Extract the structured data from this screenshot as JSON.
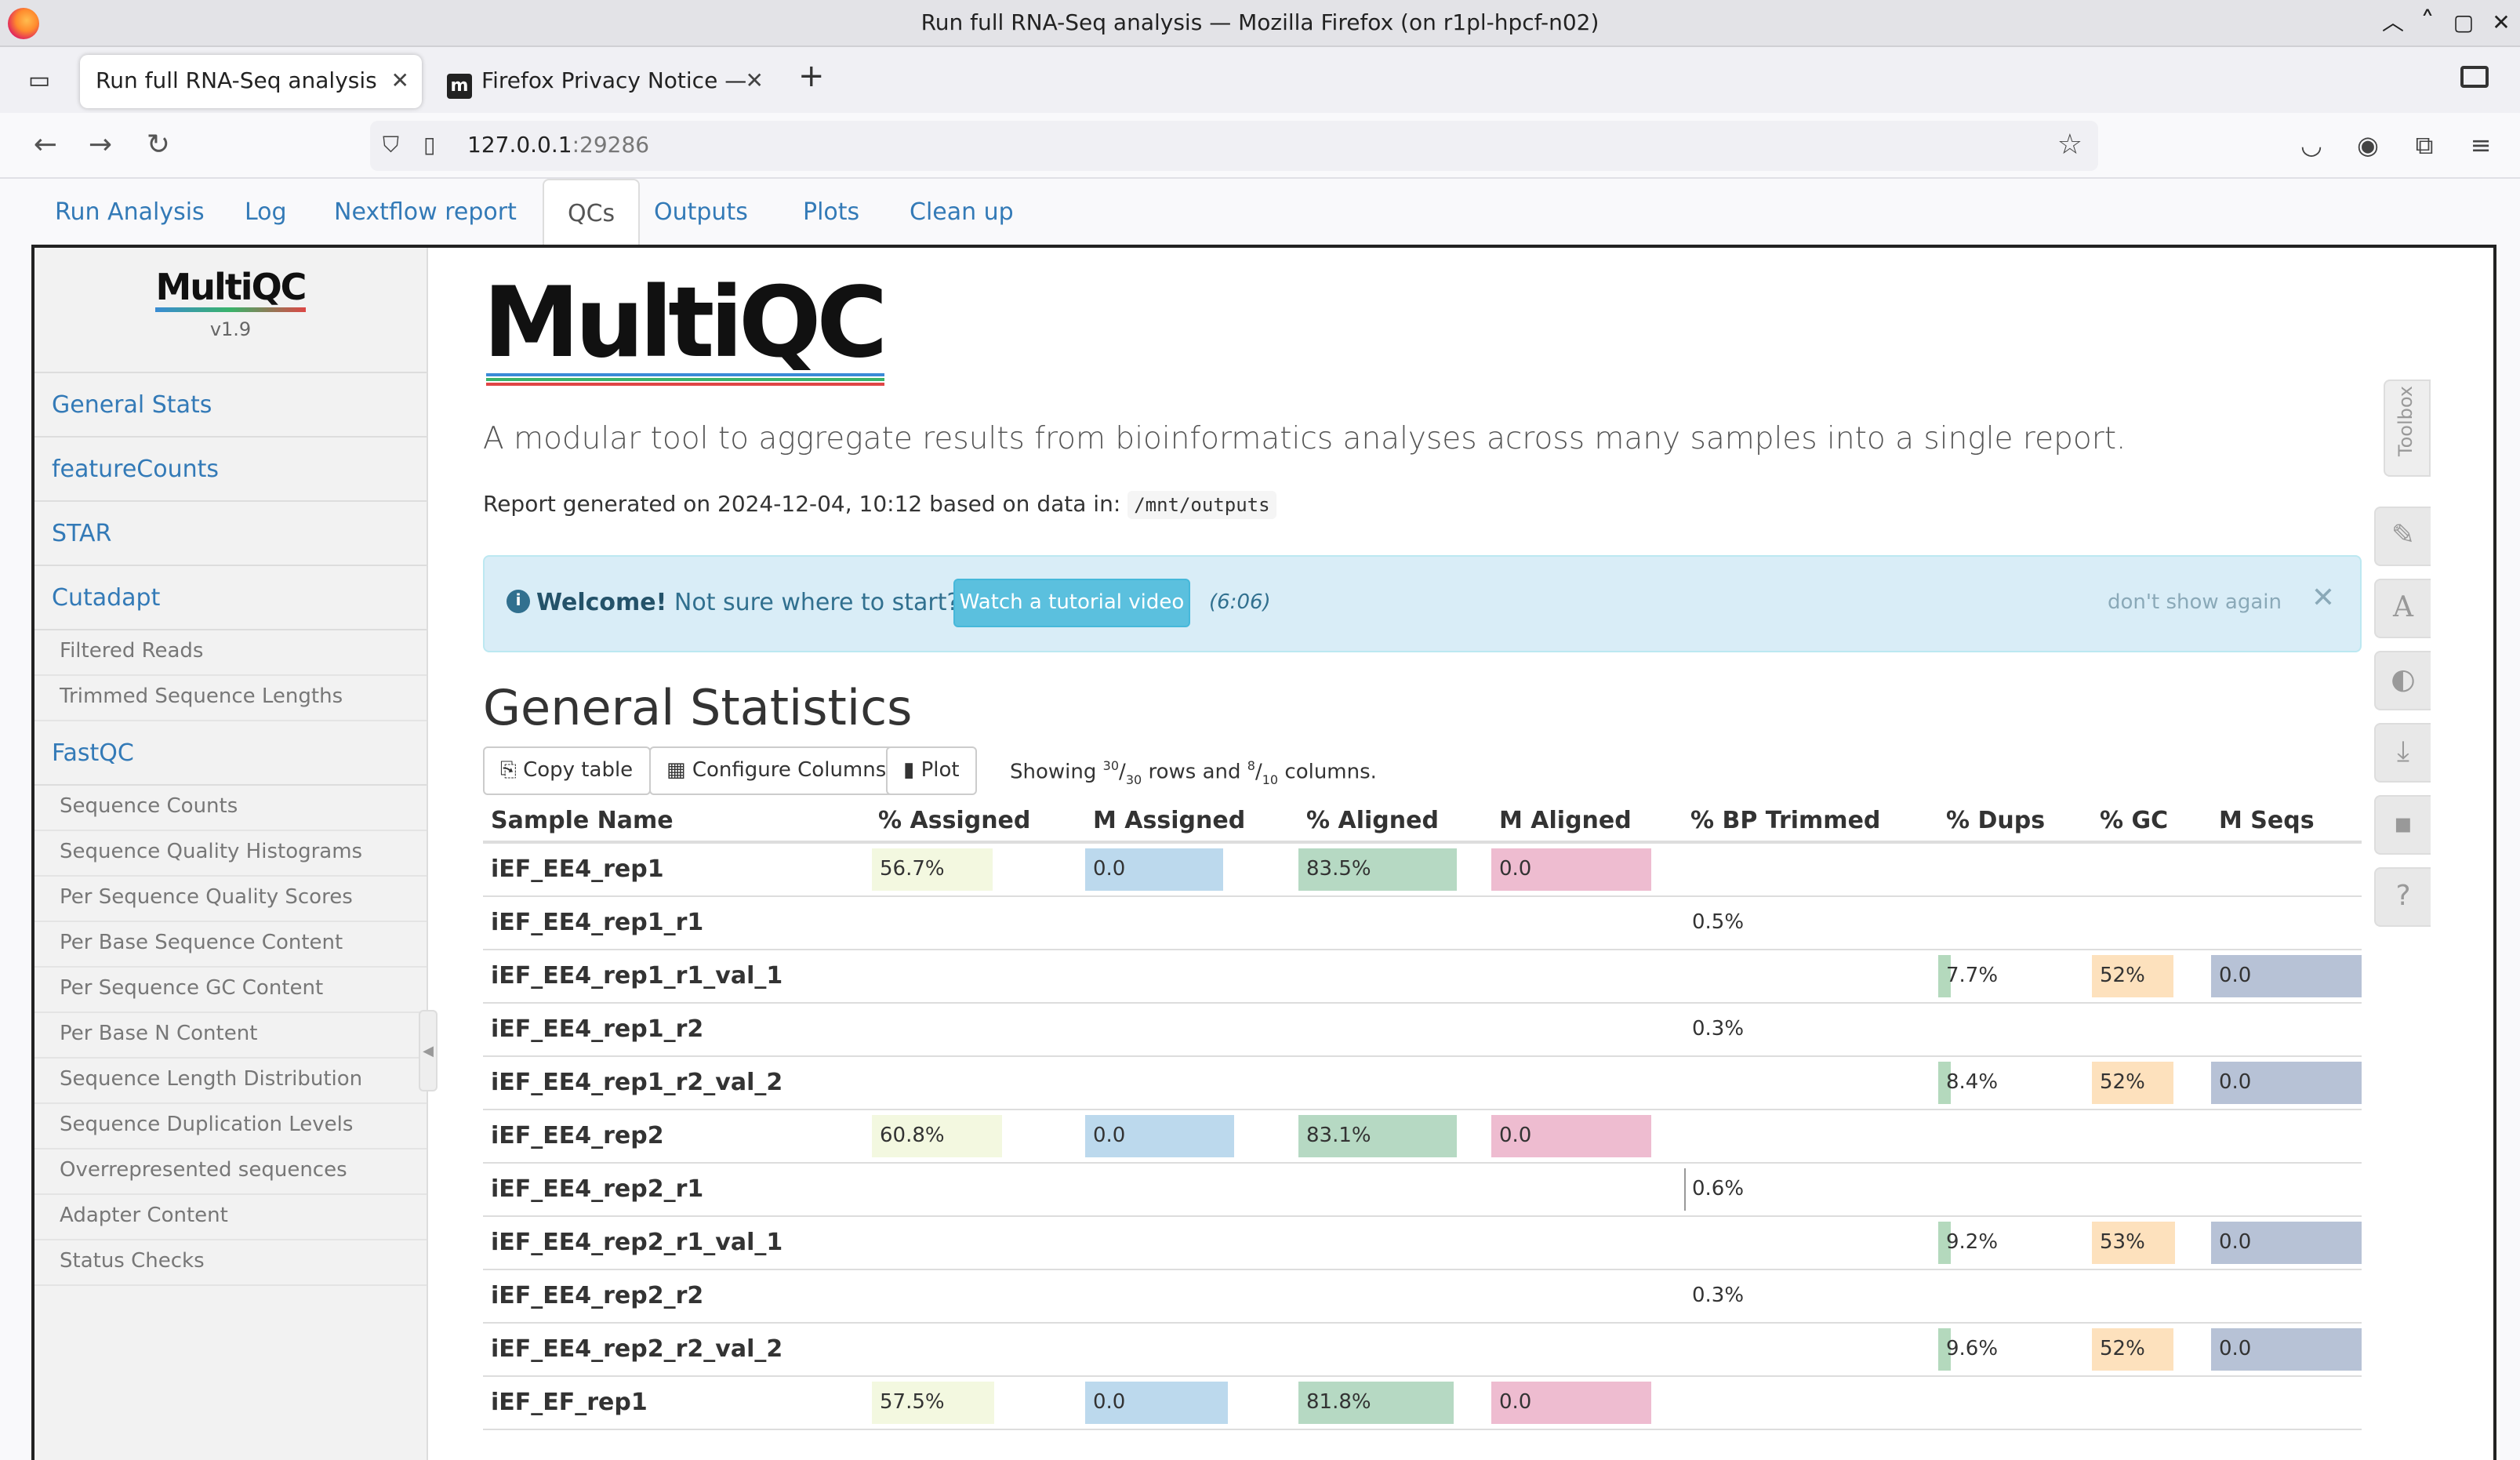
{
  "window": {
    "title": "Run full RNA-Seq analysis — Mozilla Firefox (on r1pl-hpcf-n02)"
  },
  "browser": {
    "tabs": [
      {
        "label": "Run full RNA-Seq analysis",
        "active": true
      },
      {
        "label": "Firefox Privacy Notice — ",
        "favicon": "m",
        "active": false
      }
    ],
    "url_host": "127.0.0.1",
    "url_port": ":29286"
  },
  "app_tabs": [
    "Run Analysis",
    "Log",
    "Nextflow report",
    "QCs",
    "Outputs",
    "Plots",
    "Clean up"
  ],
  "sidebar": {
    "logo": "MultiQC",
    "version": "v1.9",
    "sections": [
      {
        "label": "General Stats"
      },
      {
        "label": "featureCounts"
      },
      {
        "label": "STAR"
      },
      {
        "label": "Cutadapt",
        "subs": [
          "Filtered Reads",
          "Trimmed Sequence Lengths"
        ]
      },
      {
        "label": "FastQC",
        "subs": [
          "Sequence Counts",
          "Sequence Quality Histograms",
          "Per Sequence Quality Scores",
          "Per Base Sequence Content",
          "Per Sequence GC Content",
          "Per Base N Content",
          "Sequence Length Distribution",
          "Sequence Duplication Levels",
          "Overrepresented sequences",
          "Adapter Content",
          "Status Checks"
        ]
      }
    ]
  },
  "main": {
    "logo": "MultiQC",
    "lead": "A modular tool to aggregate results from bioinformatics analyses across many samples into a single report.",
    "generated_prefix": "Report generated on 2024-12-04, 10:12 based on data in:",
    "generated_path": "/mnt/outputs",
    "welcome_bold": "Welcome!",
    "welcome_text": "Not sure where to start?",
    "tutorial_button": "Watch a tutorial video",
    "tutorial_duration": "(6:06)",
    "dont_show": "don't show again",
    "section_title": "General Statistics",
    "buttons": {
      "copy": "Copy table",
      "configure": "Configure Columns",
      "plot": "Plot"
    },
    "showing": {
      "prefix": "Showing",
      "rows_shown": "30",
      "rows_total": "30",
      "mid": "rows and",
      "cols_shown": "8",
      "cols_total": "10",
      "suffix": "columns."
    }
  },
  "table": {
    "headers": [
      "Sample Name",
      "% Assigned",
      "M Assigned",
      "% Aligned",
      "M Aligned",
      "% BP Trimmed",
      "% Dups",
      "% GC",
      "M Seqs"
    ],
    "rows": [
      {
        "name": "iEF_EE4_rep1",
        "assigned_pct": "56.7%",
        "m_assigned": "0.0",
        "aligned_pct": "83.5%",
        "m_aligned": "0.0"
      },
      {
        "name": "iEF_EE4_rep1_r1",
        "bp_trimmed": "0.5%"
      },
      {
        "name": "iEF_EE4_rep1_r1_val_1",
        "dups": "7.7%",
        "gc": "52%",
        "m_seqs": "0.0"
      },
      {
        "name": "iEF_EE4_rep1_r2",
        "bp_trimmed": "0.3%"
      },
      {
        "name": "iEF_EE4_rep1_r2_val_2",
        "dups": "8.4%",
        "gc": "52%",
        "m_seqs": "0.0"
      },
      {
        "name": "iEF_EE4_rep2",
        "assigned_pct": "60.8%",
        "m_assigned": "0.0",
        "aligned_pct": "83.1%",
        "m_aligned": "0.0"
      },
      {
        "name": "iEF_EE4_rep2_r1",
        "bp_trimmed": "0.6%"
      },
      {
        "name": "iEF_EE4_rep2_r1_val_1",
        "dups": "9.2%",
        "gc": "53%",
        "m_seqs": "0.0"
      },
      {
        "name": "iEF_EE4_rep2_r2",
        "bp_trimmed": "0.3%"
      },
      {
        "name": "iEF_EE4_rep2_r2_val_2",
        "dups": "9.6%",
        "gc": "52%",
        "m_seqs": "0.0"
      },
      {
        "name": "iEF_EF_rep1",
        "assigned_pct": "57.5%",
        "m_assigned": "0.0",
        "aligned_pct": "81.8%",
        "m_aligned": "0.0"
      }
    ]
  },
  "toolbox": {
    "label": "Toolbox"
  },
  "colors": {
    "link": "#337ab7",
    "assigned": "#f3f8e0",
    "m_assigned": "#bcd9ed",
    "aligned": "#b6d9c3",
    "m_aligned": "#eebcd0",
    "dups": "#b4d9bd",
    "gc": "#fde1bd",
    "m_seqs": "#b7c2d6"
  }
}
